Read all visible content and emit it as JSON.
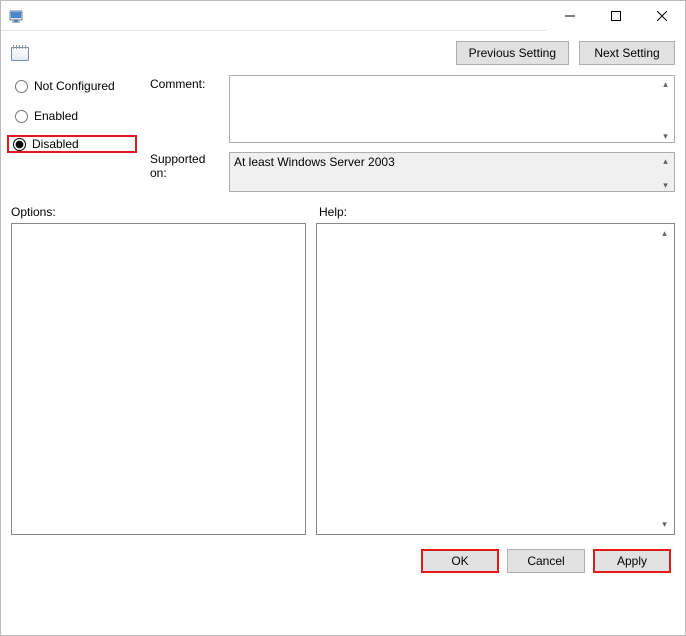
{
  "titlebar": {
    "title": ""
  },
  "nav": {
    "previous_label": "Previous Setting",
    "next_label": "Next Setting"
  },
  "radios": {
    "not_configured": "Not Configured",
    "enabled": "Enabled",
    "disabled": "Disabled",
    "selected": "disabled"
  },
  "labels": {
    "comment": "Comment:",
    "supported_on": "Supported on:",
    "options": "Options:",
    "help": "Help:"
  },
  "fields": {
    "comment_value": "",
    "supported_on_value": "At least Windows Server 2003",
    "options_content": "",
    "help_content": ""
  },
  "footer": {
    "ok": "OK",
    "cancel": "Cancel",
    "apply": "Apply"
  }
}
